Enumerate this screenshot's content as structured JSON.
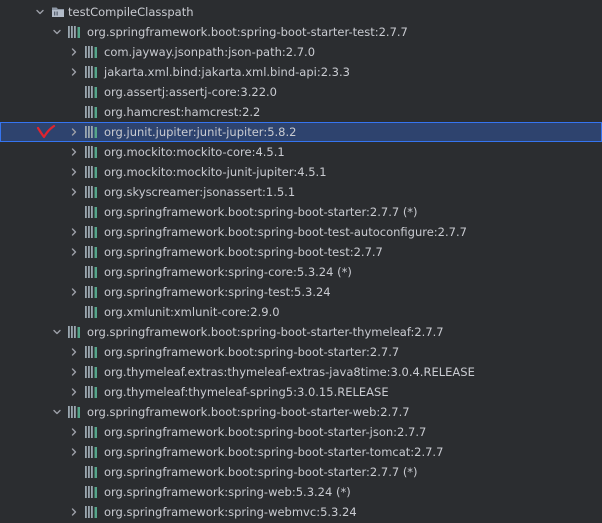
{
  "tree": {
    "root": {
      "label": "testCompileClasspath",
      "expanded": true,
      "icon": "folder-icon"
    },
    "rows": [
      {
        "label": "org.springframework.boot:spring-boot-starter-test:2.7.7",
        "level": 1,
        "arrow": "down",
        "icon": "library-icon"
      },
      {
        "label": "com.jayway.jsonpath:json-path:2.7.0",
        "level": 2,
        "arrow": "right",
        "icon": "library-icon"
      },
      {
        "label": "jakarta.xml.bind:jakarta.xml.bind-api:2.3.3",
        "level": 2,
        "arrow": "right",
        "icon": "library-icon"
      },
      {
        "label": "org.assertj:assertj-core:3.22.0",
        "level": 2,
        "arrow": "none",
        "icon": "library-icon"
      },
      {
        "label": "org.hamcrest:hamcrest:2.2",
        "level": 2,
        "arrow": "none",
        "icon": "library-icon"
      },
      {
        "label": "org.junit.jupiter:junit-jupiter:5.8.2",
        "level": 2,
        "arrow": "right",
        "icon": "library-icon",
        "selected": true,
        "annotation": "red-check-mark"
      },
      {
        "label": "org.mockito:mockito-core:4.5.1",
        "level": 2,
        "arrow": "right",
        "icon": "library-icon"
      },
      {
        "label": "org.mockito:mockito-junit-jupiter:4.5.1",
        "level": 2,
        "arrow": "right",
        "icon": "library-icon"
      },
      {
        "label": "org.skyscreamer:jsonassert:1.5.1",
        "level": 2,
        "arrow": "right",
        "icon": "library-icon"
      },
      {
        "label": "org.springframework.boot:spring-boot-starter:2.7.7 (*)",
        "level": 2,
        "arrow": "none",
        "icon": "library-icon"
      },
      {
        "label": "org.springframework.boot:spring-boot-test-autoconfigure:2.7.7",
        "level": 2,
        "arrow": "right",
        "icon": "library-icon"
      },
      {
        "label": "org.springframework.boot:spring-boot-test:2.7.7",
        "level": 2,
        "arrow": "right",
        "icon": "library-icon"
      },
      {
        "label": "org.springframework:spring-core:5.3.24 (*)",
        "level": 2,
        "arrow": "none",
        "icon": "library-icon"
      },
      {
        "label": "org.springframework:spring-test:5.3.24",
        "level": 2,
        "arrow": "right",
        "icon": "library-icon"
      },
      {
        "label": "org.xmlunit:xmlunit-core:2.9.0",
        "level": 2,
        "arrow": "none",
        "icon": "library-icon"
      },
      {
        "label": "org.springframework.boot:spring-boot-starter-thymeleaf:2.7.7",
        "level": 1,
        "arrow": "down",
        "icon": "library-icon"
      },
      {
        "label": "org.springframework.boot:spring-boot-starter:2.7.7",
        "level": 2,
        "arrow": "right",
        "icon": "library-icon"
      },
      {
        "label": "org.thymeleaf.extras:thymeleaf-extras-java8time:3.0.4.RELEASE",
        "level": 2,
        "arrow": "right",
        "icon": "library-icon"
      },
      {
        "label": "org.thymeleaf:thymeleaf-spring5:3.0.15.RELEASE",
        "level": 2,
        "arrow": "right",
        "icon": "library-icon"
      },
      {
        "label": "org.springframework.boot:spring-boot-starter-web:2.7.7",
        "level": 1,
        "arrow": "down",
        "icon": "library-icon"
      },
      {
        "label": "org.springframework.boot:spring-boot-starter-json:2.7.7",
        "level": 2,
        "arrow": "right",
        "icon": "library-icon"
      },
      {
        "label": "org.springframework.boot:spring-boot-starter-tomcat:2.7.7",
        "level": 2,
        "arrow": "right",
        "icon": "library-icon"
      },
      {
        "label": "org.springframework.boot:spring-boot-starter:2.7.7 (*)",
        "level": 2,
        "arrow": "none",
        "icon": "library-icon"
      },
      {
        "label": "org.springframework:spring-web:5.3.24 (*)",
        "level": 2,
        "arrow": "none",
        "icon": "library-icon"
      },
      {
        "label": "org.springframework:spring-webmvc:5.3.24",
        "level": 2,
        "arrow": "right",
        "icon": "library-icon"
      }
    ]
  },
  "colors": {
    "background": "#2b2d30",
    "text": "#c9cbd1",
    "arrow": "#9da0a8",
    "library_icon_bars": "#9aa7b0",
    "library_icon_accent": "#55a58a",
    "selection_bg": "#2e436e",
    "selection_border": "#3574f0",
    "annotation": "#e0242f"
  }
}
